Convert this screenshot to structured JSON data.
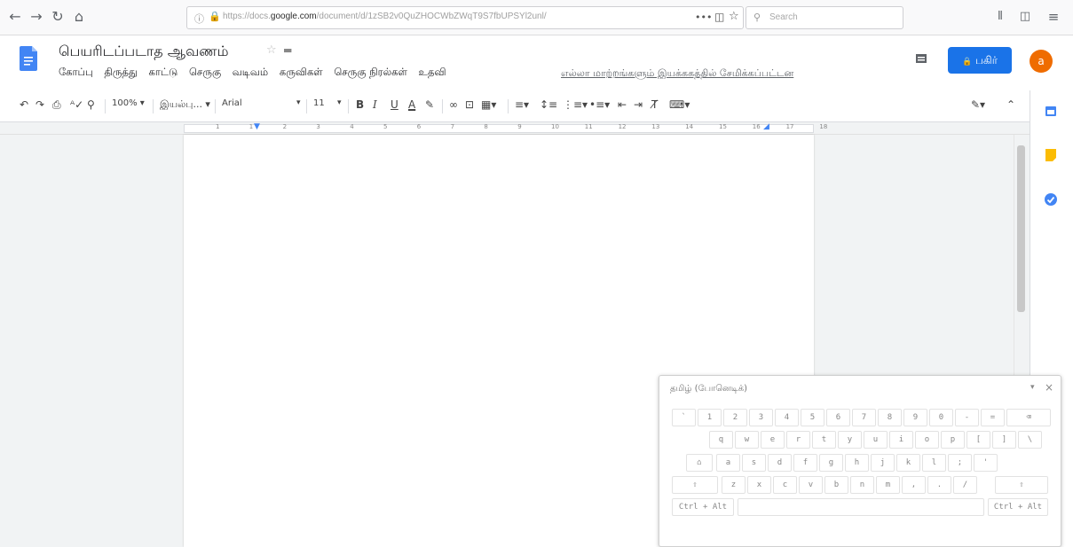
{
  "browser": {
    "url_prefix": "https://docs.",
    "url_domain": "google.com",
    "url_path": "/document/d/1zSB2v0QuZHOCWbZWqT9S7fbUPSYl2unl/",
    "more_label": "•••",
    "search_placeholder": "Search"
  },
  "doc": {
    "title": "பெயரிடப்படாத ஆவணம்",
    "menu": [
      "கோப்பு",
      "திருத்து",
      "காட்டு",
      "செருகு",
      "வடிவம்",
      "கருவிகள்",
      "செருகு நிரல்கள்",
      "உதவி"
    ],
    "last_edit": "எல்லா மாற்றங்களும் இயக்ககத்தில் சேமிக்கப்பட்டன",
    "share_label": "பகிர்",
    "avatar_letter": "a"
  },
  "toolbar": {
    "zoom": "100%",
    "style": "இயல்பு...",
    "font": "Arial",
    "size": "11",
    "bold": "B",
    "italic": "I",
    "underline": "U",
    "text_color": "A"
  },
  "ruler": {
    "ticks": [
      "1",
      "1",
      "2",
      "3",
      "4",
      "5",
      "6",
      "7",
      "8",
      "9",
      "10",
      "11",
      "12",
      "13",
      "14",
      "15",
      "16",
      "17",
      "18"
    ]
  },
  "keyboard": {
    "title": "தமிழ் (போனெடிக்)",
    "rows": [
      [
        "`",
        "1",
        "2",
        "3",
        "4",
        "5",
        "6",
        "7",
        "8",
        "9",
        "0",
        "-",
        "="
      ],
      [
        "q",
        "w",
        "e",
        "r",
        "t",
        "y",
        "u",
        "i",
        "o",
        "p",
        "[",
        "]",
        "\\"
      ],
      [
        "a",
        "s",
        "d",
        "f",
        "g",
        "h",
        "j",
        "k",
        "l",
        ";",
        "'"
      ],
      [
        "z",
        "x",
        "c",
        "v",
        "b",
        "n",
        "m",
        ",",
        ".",
        "/"
      ]
    ],
    "ctrl_alt_left": "Ctrl + Alt",
    "ctrl_alt_right": "Ctrl + Alt"
  },
  "colors": {
    "accent": "#1a73e8",
    "avatar": "#ef6c00",
    "docs_icon": "#4285f4",
    "keep_icon": "#fbbc04"
  }
}
